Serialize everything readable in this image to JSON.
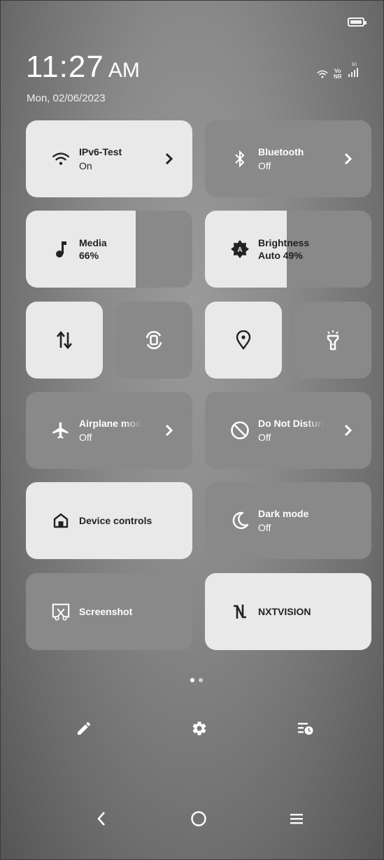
{
  "status_bar": {
    "time": "11:27",
    "ampm": "AM",
    "date": "Mon, 02/06/2023",
    "volte_top": "Vo",
    "volte_bottom": "NR",
    "network": "5G"
  },
  "tiles": {
    "wifi": {
      "title": "IPv6-Test",
      "status": "On",
      "state": "on",
      "icon": "wifi-icon"
    },
    "bluetooth": {
      "title": "Bluetooth",
      "status": "Off",
      "state": "off",
      "icon": "bluetooth-icon"
    },
    "media": {
      "title": "Media",
      "value": "66%",
      "level": 0.66,
      "icon": "music-note-icon"
    },
    "brightness": {
      "title": "Brightness",
      "value": "Auto 49%",
      "level": 0.49,
      "icon": "brightness-auto-icon"
    },
    "mobile_data": {
      "state": "on",
      "icon": "mobile-data-icon"
    },
    "auto_rotate": {
      "state": "off",
      "icon": "auto-rotate-icon"
    },
    "location": {
      "state": "on",
      "icon": "location-pin-icon"
    },
    "flashlight": {
      "state": "off",
      "icon": "flashlight-icon"
    },
    "airplane": {
      "title": "Airplane mode",
      "status": "Off",
      "state": "off",
      "icon": "airplane-icon"
    },
    "dnd": {
      "title": "Do Not Disturb",
      "status": "Off",
      "state": "off",
      "icon": "do-not-disturb-icon"
    },
    "device_controls": {
      "title": "Device controls",
      "state": "on",
      "icon": "home-icon"
    },
    "dark_mode": {
      "title": "Dark mode",
      "status": "Off",
      "state": "off",
      "icon": "moon-icon"
    },
    "screenshot": {
      "title": "Screenshot",
      "state": "off",
      "icon": "screenshot-icon"
    },
    "nxtvision": {
      "title": "NXTVISION",
      "state": "on",
      "icon": "nxtvision-icon"
    }
  },
  "pager": {
    "pages": 2,
    "current": 1
  },
  "actions": [
    "edit-icon",
    "settings-gear-icon",
    "notification-history-icon"
  ],
  "nav": [
    "back-icon",
    "home-circle-icon",
    "menu-icon"
  ],
  "colors": {
    "tile_on": "#e9e9e9",
    "tile_off": "#898989"
  }
}
